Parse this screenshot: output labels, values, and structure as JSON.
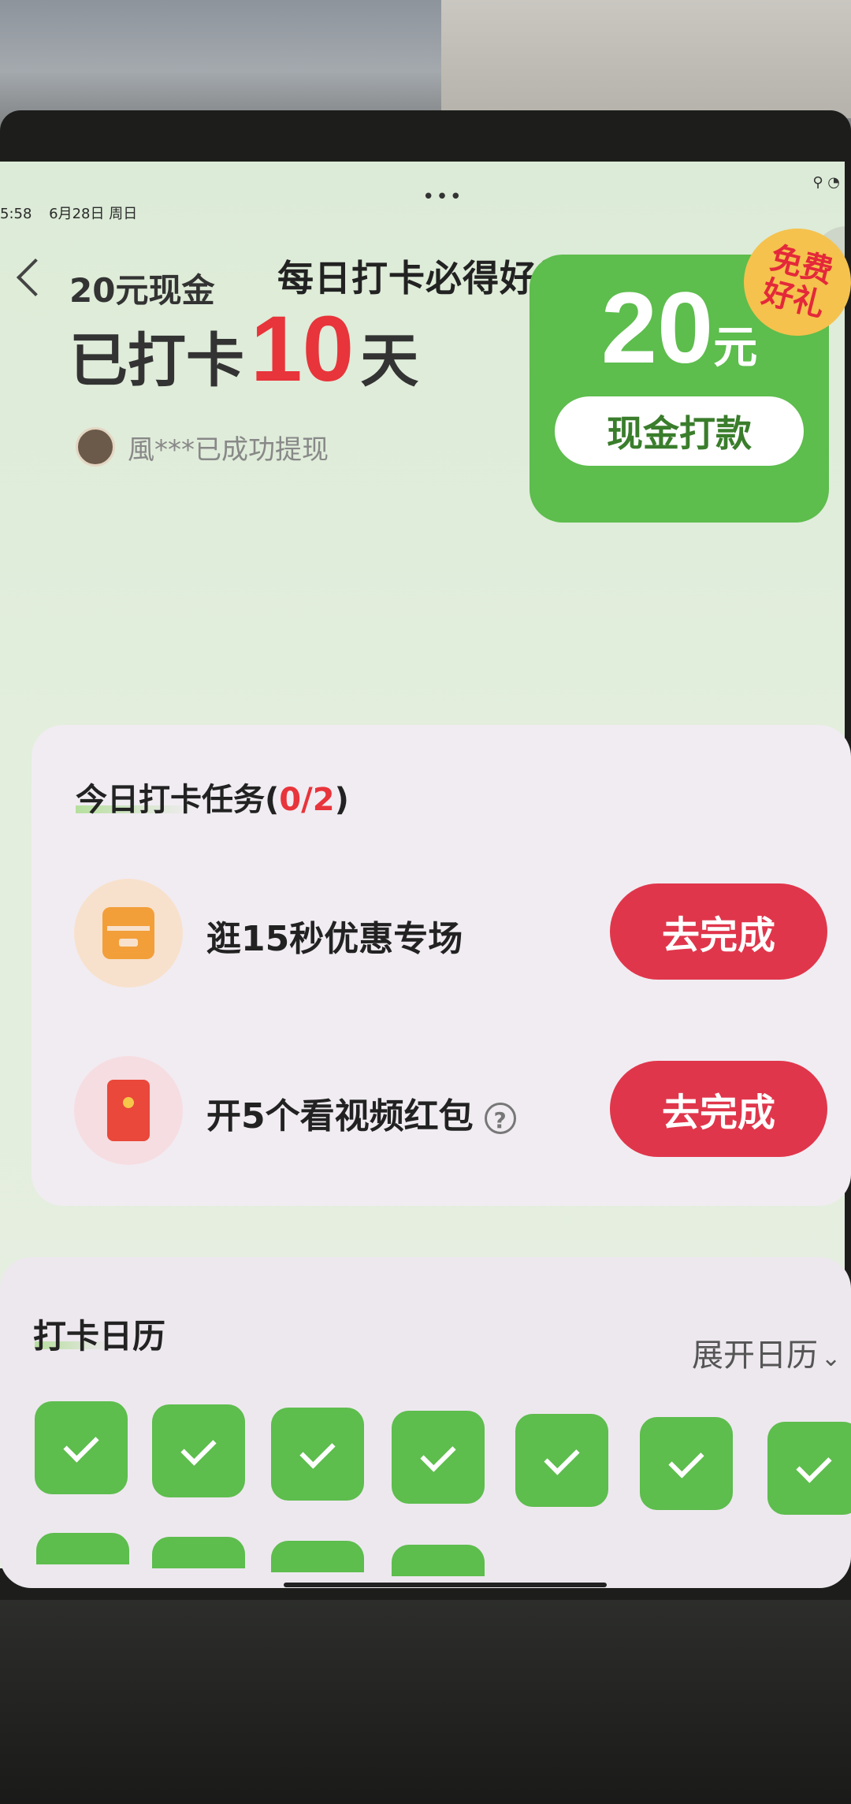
{
  "status": {
    "time": "5:58",
    "date": "6月28日 周日"
  },
  "header": {
    "title": "每日打卡必得好礼"
  },
  "hero": {
    "cash_label": "20元现金",
    "checkin_prefix": "已打卡",
    "checkin_days": "10",
    "checkin_suffix": "天",
    "withdraw_text": "風***已成功提现",
    "reward_amount": "20",
    "reward_unit": "元",
    "reward_button": "现金打款",
    "badge_line1": "免费",
    "badge_line2": "好礼"
  },
  "tasks": {
    "title": "今日打卡任务(",
    "progress": "0/2",
    "title_close": ")",
    "items": [
      {
        "label": "逛15秒优惠专场",
        "button": "去完成",
        "icon": "shop-icon"
      },
      {
        "label": "开5个看视频红包",
        "button": "去完成",
        "icon": "red-packet-icon",
        "help": "?"
      }
    ]
  },
  "calendar": {
    "title": "打卡日历",
    "expand_label": "展开日历",
    "checked_days": 11
  },
  "colors": {
    "accent_green": "#5dbd4d",
    "accent_red": "#e0364b",
    "badge_yellow": "#f5c24d"
  }
}
